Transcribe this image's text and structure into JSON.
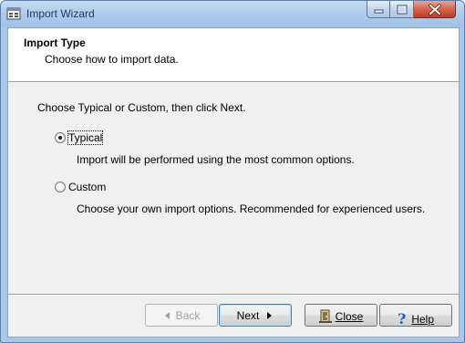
{
  "window": {
    "title": "Import Wizard"
  },
  "header": {
    "title": "Import Type",
    "subtitle": "Choose how to import data."
  },
  "body": {
    "instruction": "Choose Typical or Custom, then click Next.",
    "options": [
      {
        "label": "Typical",
        "description": "Import will be performed using the most common options.",
        "selected": true
      },
      {
        "label": "Custom",
        "description": "Choose your own import options. Recommended for experienced users.",
        "selected": false
      }
    ]
  },
  "buttons": {
    "back": "Back",
    "next": "Next",
    "close": "Close",
    "help": "Help"
  },
  "icons": {
    "app": "import-wizard-app-icon",
    "back": "left-arrow-icon",
    "next": "right-arrow-icon",
    "close": "door-icon",
    "help": "question-mark-icon"
  },
  "colors": {
    "titlebar": "#afcbea",
    "close_button": "#c94a30",
    "help_icon": "#1c5fc8"
  }
}
